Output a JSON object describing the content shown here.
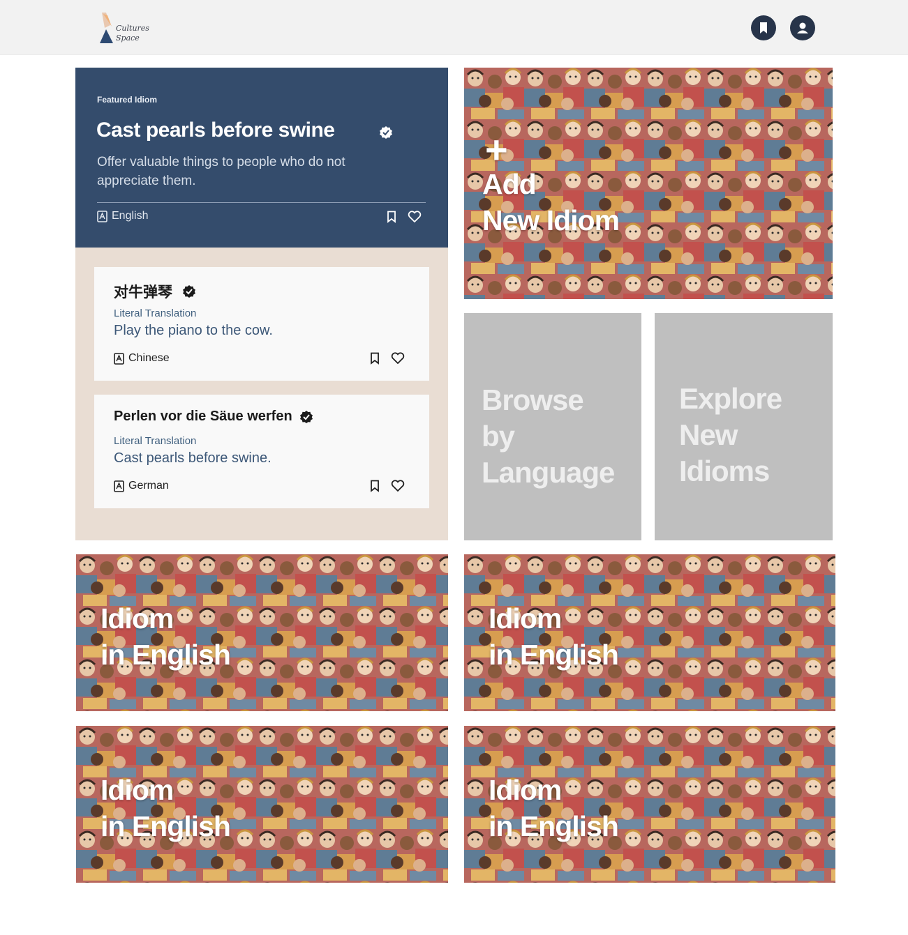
{
  "brand": {
    "line1": "Cultures",
    "line2": "Space"
  },
  "header": {
    "icons": [
      "bookmark-icon",
      "user-icon"
    ],
    "accent": "#27344a"
  },
  "featured": {
    "eyebrow": "Featured Idiom",
    "title": "Cast pearls before swine",
    "description": "Offer valuable things to people who do not appreciate them.",
    "language": "English",
    "color": "#344c6c"
  },
  "related": [
    {
      "name": "对牛弹琴",
      "literal_label": "Literal Translation",
      "literal": "Play the piano to the cow.",
      "language": "Chinese"
    },
    {
      "name": "Perlen vor die Säue werfen",
      "literal_label": "Literal Translation",
      "literal": "Cast pearls before swine.",
      "language": "German"
    }
  ],
  "tiles": {
    "add": {
      "plus": "+",
      "line1": "Add",
      "line2": "New Idiom"
    },
    "browse": {
      "line1": "Browse",
      "line2": "by",
      "line3": "Language"
    },
    "explore": {
      "line1": "Explore",
      "line2": "New",
      "line3": "Idioms"
    },
    "idiom_tiles": [
      {
        "line1": "Idiom",
        "line2": "in English"
      },
      {
        "line1": "Idiom",
        "line2": "in English"
      },
      {
        "line1": "Idiom",
        "line2": "in English"
      },
      {
        "line1": "Idiom",
        "line2": "in English"
      }
    ]
  }
}
